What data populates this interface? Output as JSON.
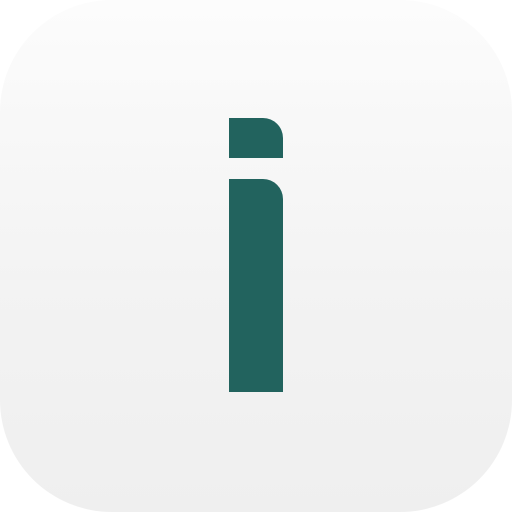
{
  "app_icon": {
    "icon": "letter-i-logo-icon",
    "background_color": "#f6f6f6",
    "glyph_color": "#22635e"
  }
}
